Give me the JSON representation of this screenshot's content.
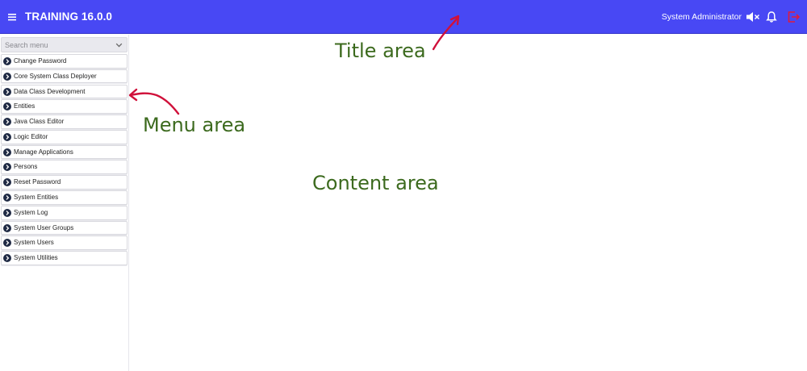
{
  "header": {
    "title": "TRAINING 16.0.0",
    "user": "System Administrator",
    "background": "#4848f4",
    "icons": [
      "hamburger-icon",
      "mute-icon",
      "bell-icon",
      "logout-icon"
    ]
  },
  "sidebar": {
    "search_placeholder": "Search menu",
    "items": [
      {
        "label": "Change Password"
      },
      {
        "label": "Core System Class Deployer"
      },
      {
        "label": "Data Class Development"
      },
      {
        "label": "Entities"
      },
      {
        "label": "Java Class Editor"
      },
      {
        "label": "Logic Editor"
      },
      {
        "label": "Manage Applications"
      },
      {
        "label": "Persons"
      },
      {
        "label": "Reset Password"
      },
      {
        "label": "System Entities"
      },
      {
        "label": "System Log"
      },
      {
        "label": "System User Groups"
      },
      {
        "label": "System Users"
      },
      {
        "label": "System Utilities"
      }
    ]
  },
  "annotations": {
    "title_area": "Title area",
    "menu_area": "Menu area",
    "content_area": "Content area",
    "text_color": "#3c6a1e",
    "arrow_color": "#d0103a"
  }
}
